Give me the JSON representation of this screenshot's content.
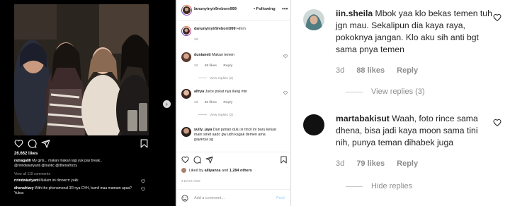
{
  "panel_left": {
    "likes": "26.662 likes",
    "caption": {
      "username": "ratnagalih",
      "text": "My girls... makan makan lagi yuk pas break..",
      "tags": "@ririndwiariyanti @riantic @dhenafrizzy"
    },
    "view_all": "View all 119 comments",
    "comments": [
      {
        "username": "ririndwiariyanti",
        "text": "Malam ini dinnerrrr yukk"
      },
      {
        "username": "dhenafrizzy",
        "text": "With the phenomenal 3R nya CYH, bumil mau mamam apaa? Yukss"
      }
    ]
  },
  "panel_middle": {
    "header": {
      "username": "lanunyinyir9reborn999",
      "separator": "•",
      "follow_label": "Following",
      "more": "•••"
    },
    "caption": {
      "username": "danunyinyir9reborn999",
      "text": "Hmm",
      "time": "3d"
    },
    "comments": [
      {
        "username": "dunianeti",
        "text": "Makan temen",
        "time": "3d",
        "likes": "48 likes",
        "reply": "Reply",
        "view_replies": "View replies (2)"
      },
      {
        "username": "alfrya",
        "text": "Juice pokat nya ilang min",
        "time": "3d",
        "likes": "50 likes",
        "reply": "Reply",
        "view_replies": "View replies (2)"
      },
      {
        "username": "yully_jaya",
        "text": "Dari jaman dulu si rincil ini baru keluar main sinet aadc gw udh kagak demen ama gayanya yg",
        "time": "",
        "likes": "",
        "reply": "",
        "view_replies": ""
      }
    ],
    "liked_by": {
      "prefix": "Liked by",
      "user": "alliyanza",
      "conj": "and",
      "others": "1,284 others"
    },
    "date": "3 DAYS AGO",
    "add_comment": {
      "placeholder": "Add a comment...",
      "post_label": "Post"
    }
  },
  "panel_right": {
    "comments": [
      {
        "username": "iin.sheila",
        "text": "Mbok yaa klo bekas temen tuh jgn mau. Sekalipun dia kaya raya, pokoknya jangan. Klo aku sih anti bgt sama pnya temen",
        "time": "3d",
        "likes": "88 likes",
        "reply": "Reply",
        "view_replies": "View replies (3)"
      },
      {
        "username": "martabakisut",
        "text": "Waah, foto rince sama dhena, bisa jadi kaya moon sama tini nih, punya teman dihabek juga",
        "time": "3d",
        "likes": "79 likes",
        "reply": "Reply",
        "view_replies": "Hide replies"
      }
    ]
  },
  "icons": {
    "heart": "heart-icon",
    "comment": "comment-icon",
    "share": "share-icon",
    "bookmark": "bookmark-icon",
    "next": "chevron-right-icon",
    "emoji": "emoji-icon"
  },
  "colors": {
    "dark_bg": "#000000",
    "link_blue": "#3897f0",
    "muted_text": "#8e8e8e",
    "post_disabled": "#b3dbff"
  },
  "carousel": {
    "count": 5,
    "active": 2
  }
}
